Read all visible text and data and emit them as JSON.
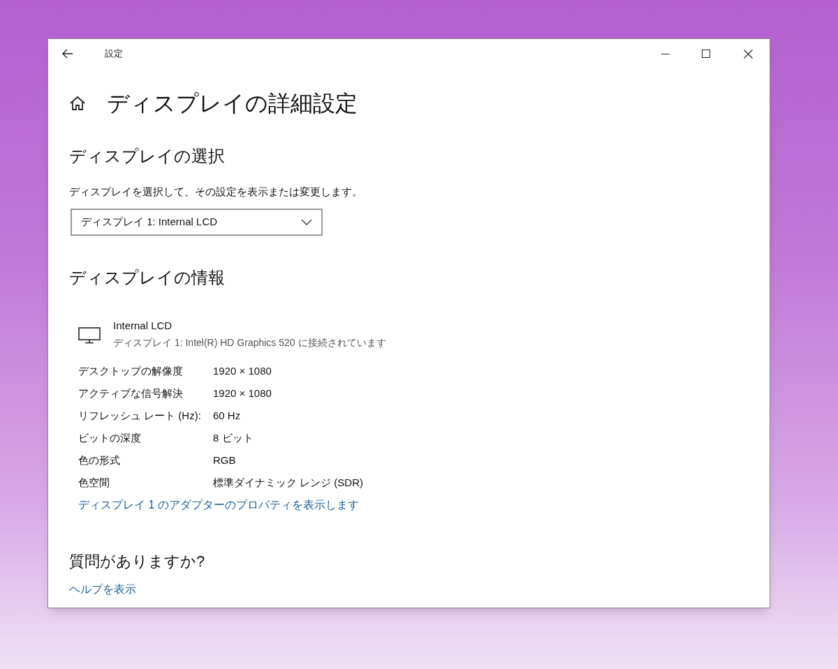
{
  "window": {
    "title": "設定"
  },
  "page_title": "ディスプレイの詳細設定",
  "select_section": {
    "heading": "ディスプレイの選択",
    "description": "ディスプレイを選択して、その設定を表示または変更します。",
    "dropdown": {
      "value": "ディスプレイ 1: Internal LCD"
    }
  },
  "info_section": {
    "heading": "ディスプレイの情報",
    "display_name": "Internal LCD",
    "connection": "ディスプレイ 1: Intel(R) HD Graphics 520 に接続されています",
    "rows": [
      {
        "label": "デスクトップの解像度",
        "value": "1920 × 1080"
      },
      {
        "label": "アクティブな信号解決",
        "value": "1920 × 1080"
      },
      {
        "label": "リフレッシュ レート (Hz):",
        "value": "60 Hz"
      },
      {
        "label": "ビットの深度",
        "value": "8 ビット"
      },
      {
        "label": "色の形式",
        "value": "RGB"
      },
      {
        "label": "色空間",
        "value": "標準ダイナミック レンジ (SDR)"
      }
    ],
    "link": "ディスプレイ 1 のアダプターのプロパティを表示します"
  },
  "help_section": {
    "heading": "質問がありますか?",
    "link": "ヘルプを表示"
  }
}
